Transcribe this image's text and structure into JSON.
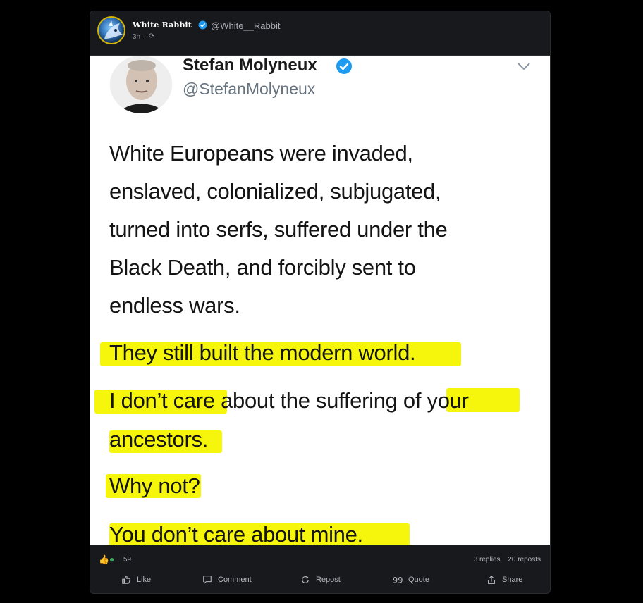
{
  "post": {
    "author_name": "White Rabbit",
    "author_handle": "@White__Rabbit",
    "time": "3h ·",
    "visibility_icon": "globe-icon"
  },
  "embedded_tweet": {
    "name": "Stefan Molyneux",
    "handle": "@StefanMolyneux",
    "lines": [
      "White Europeans were invaded,",
      "enslaved, colonialized, subjugated,",
      "turned into serfs, suffered under the",
      "Black Death, and forcibly sent to",
      "endless wars.",
      "They still built the modern world.",
      "I don’t care about the suffering of your",
      "ancestors.",
      "Why not?",
      "You don’t care about mine."
    ],
    "highlight_color": "#f5f500"
  },
  "stats": {
    "reaction_count": "59",
    "replies": "3 replies",
    "reposts": "20 reposts"
  },
  "actions": {
    "like": "Like",
    "comment": "Comment",
    "repost": "Repost",
    "quote": "Quote",
    "share": "Share"
  },
  "colors": {
    "card_bg": "#18191c",
    "verified": "#1d9bf0",
    "highlight": "#f5f500"
  }
}
